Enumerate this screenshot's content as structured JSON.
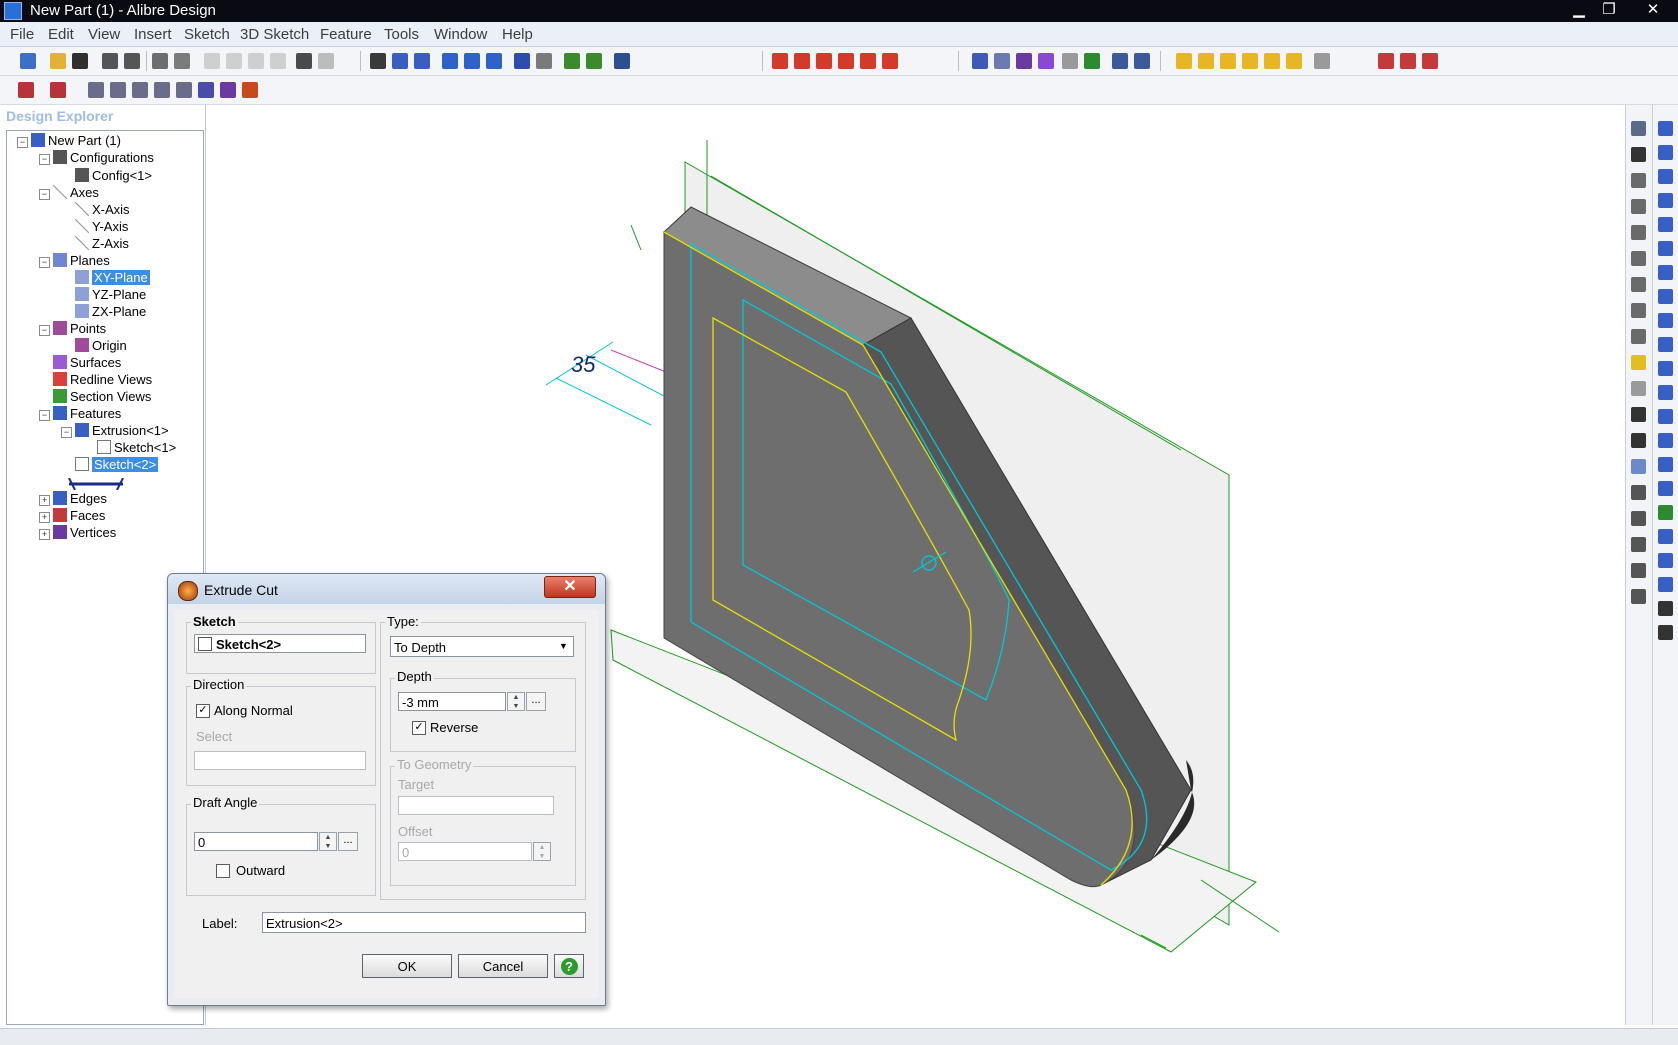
{
  "window": {
    "title": "New Part (1) - Alibre Design"
  },
  "menu": [
    "File",
    "Edit",
    "View",
    "Insert",
    "Sketch",
    "3D Sketch",
    "Feature",
    "Tools",
    "Window",
    "Help"
  ],
  "explorer": {
    "title": "Design Explorer",
    "tree": [
      {
        "label": "New Part (1)",
        "icon": "part-icon"
      },
      {
        "label": "Configurations",
        "icon": "configurations-icon"
      },
      {
        "label": "Config<1>",
        "icon": "config-icon"
      },
      {
        "label": "Axes",
        "icon": "axes-icon"
      },
      {
        "label": "X-Axis",
        "icon": "axis-icon"
      },
      {
        "label": "Y-Axis",
        "icon": "axis-icon"
      },
      {
        "label": "Z-Axis",
        "icon": "axis-icon"
      },
      {
        "label": "Planes",
        "icon": "planes-icon"
      },
      {
        "label": "XY-Plane",
        "icon": "plane-icon"
      },
      {
        "label": "YZ-Plane",
        "icon": "plane-icon"
      },
      {
        "label": "ZX-Plane",
        "icon": "plane-icon"
      },
      {
        "label": "Points",
        "icon": "points-icon"
      },
      {
        "label": "Origin",
        "icon": "origin-icon"
      },
      {
        "label": "Surfaces",
        "icon": "surfaces-icon"
      },
      {
        "label": "Redline Views",
        "icon": "redline-icon"
      },
      {
        "label": "Section Views",
        "icon": "section-icon"
      },
      {
        "label": "Features",
        "icon": "features-icon"
      },
      {
        "label": "Extrusion<1>",
        "icon": "extrusion-icon"
      },
      {
        "label": "Sketch<1>",
        "icon": "sketch-icon"
      },
      {
        "label": "Sketch<2>",
        "icon": "sketch-icon"
      },
      {
        "label": "Edges",
        "icon": "edges-icon"
      },
      {
        "label": "Faces",
        "icon": "faces-icon"
      },
      {
        "label": "Vertices",
        "icon": "vertices-icon"
      }
    ]
  },
  "viewport": {
    "dimension_label": "35"
  },
  "dialog": {
    "title": "Extrude Cut",
    "close": "✕",
    "sketch": {
      "label": "Sketch",
      "value": "Sketch<2>"
    },
    "direction": {
      "label": "Direction",
      "along_normal": "Along Normal",
      "along_normal_checked": true,
      "select_label": "Select",
      "select_value": ""
    },
    "draft_angle": {
      "label": "Draft Angle",
      "value": "0",
      "outward": "Outward",
      "outward_checked": false
    },
    "type": {
      "label": "Type:",
      "value": "To Depth"
    },
    "depth": {
      "label": "Depth",
      "value": "-3 mm",
      "reverse": "Reverse",
      "reverse_checked": true
    },
    "to_geometry": {
      "label": "To Geometry",
      "target_label": "Target",
      "target_value": "",
      "offset_label": "Offset",
      "offset_value": "0"
    },
    "label_field": {
      "label": "Label:",
      "value": "Extrusion<2>"
    },
    "ok": "OK",
    "cancel": "Cancel",
    "help": "?"
  },
  "colors": {
    "accent": "#3b8ee6",
    "model_face": "#6e6e6e",
    "sketch_yellow": "#e6e000",
    "sketch_cyan": "#00c8d8",
    "plane_green": "#1e9a1e"
  }
}
